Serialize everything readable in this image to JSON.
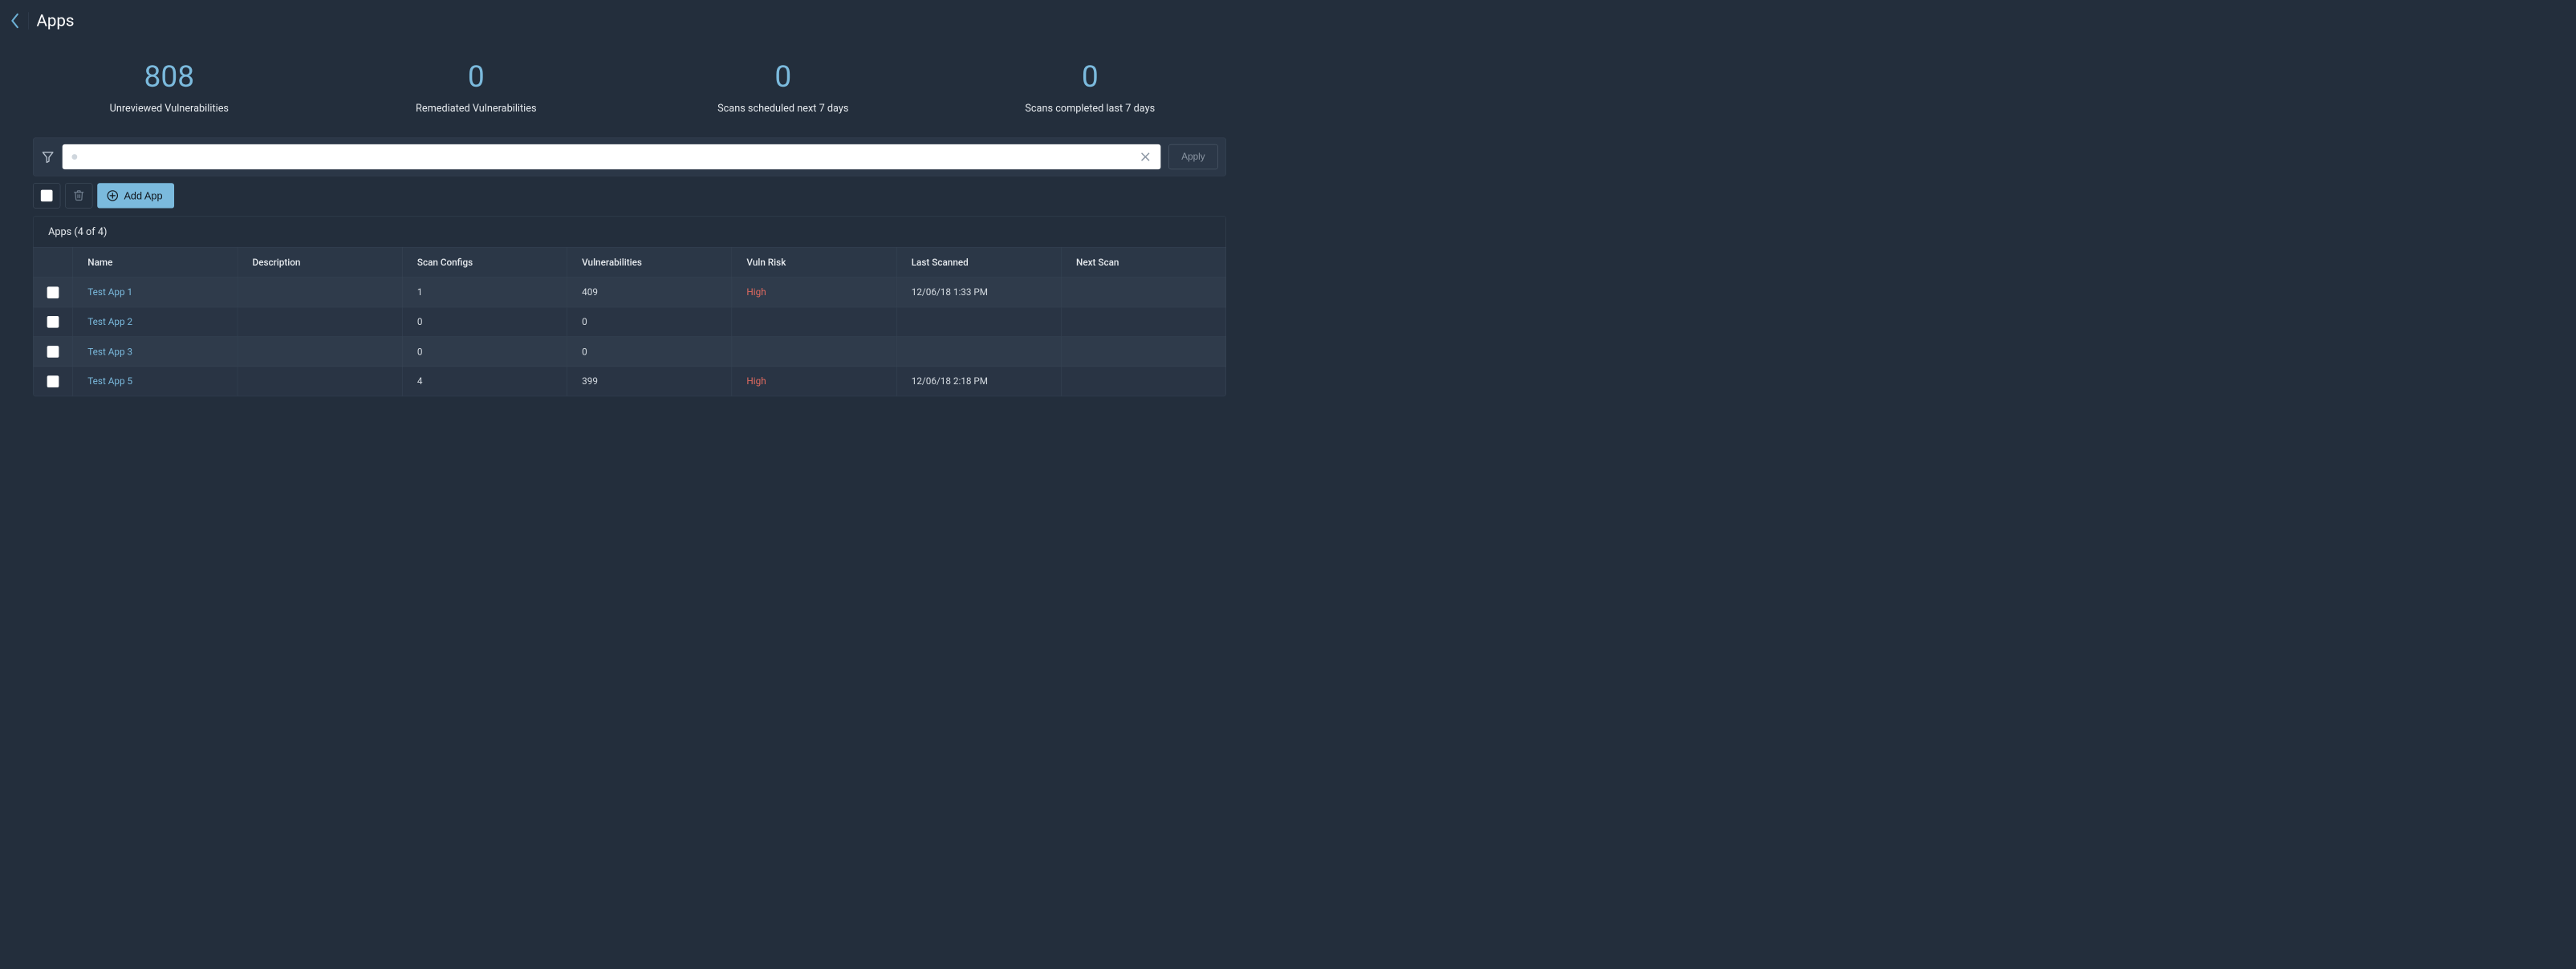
{
  "header": {
    "title": "Apps"
  },
  "stats": [
    {
      "value": "808",
      "label": "Unreviewed Vulnerabilities"
    },
    {
      "value": "0",
      "label": "Remediated Vulnerabilities"
    },
    {
      "value": "0",
      "label": "Scans scheduled next 7 days"
    },
    {
      "value": "0",
      "label": "Scans completed last 7 days"
    }
  ],
  "filter": {
    "search_value": "",
    "apply_label": "Apply"
  },
  "toolbar": {
    "add_label": "Add App"
  },
  "table": {
    "title": "Apps (4 of 4)",
    "columns": {
      "name": "Name",
      "description": "Description",
      "scan_configs": "Scan Configs",
      "vulnerabilities": "Vulnerabilities",
      "vuln_risk": "Vuln Risk",
      "last_scanned": "Last Scanned",
      "next_scan": "Next Scan"
    },
    "rows": [
      {
        "name": "Test App 1",
        "description": "",
        "scan_configs": "1",
        "vulnerabilities": "409",
        "vuln_risk": "High",
        "last_scanned": "12/06/18 1:33 PM",
        "next_scan": ""
      },
      {
        "name": "Test App 2",
        "description": "",
        "scan_configs": "0",
        "vulnerabilities": "0",
        "vuln_risk": "",
        "last_scanned": "",
        "next_scan": ""
      },
      {
        "name": "Test App 3",
        "description": "",
        "scan_configs": "0",
        "vulnerabilities": "0",
        "vuln_risk": "",
        "last_scanned": "",
        "next_scan": ""
      },
      {
        "name": "Test App 5",
        "description": "",
        "scan_configs": "4",
        "vulnerabilities": "399",
        "vuln_risk": "High",
        "last_scanned": "12/06/18 2:18 PM",
        "next_scan": ""
      }
    ]
  },
  "colors": {
    "accent": "#7bbadd",
    "risk_high": "#e06a5f"
  }
}
